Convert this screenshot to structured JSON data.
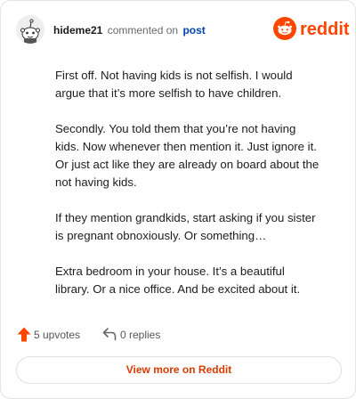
{
  "header": {
    "username": "hideme21",
    "commented_text": "commented on",
    "post_link": "post",
    "brand_wordmark": "reddit"
  },
  "comment": {
    "paragraphs": [
      "First off. Not having kids is not selfish. I would argue that it’s more selfish to have children.",
      "Secondly. You told them that you’re not having kids. Now whenever then mention it. Just ignore it. Or just act like they are already on board about the not having kids.",
      "If they mention grandkids, start asking if you sister is pregnant obnoxiously. Or something…",
      "Extra bedroom in your house. It’s a beautiful library. Or a nice office. And be excited about it."
    ]
  },
  "footer": {
    "upvotes_label": "5 upvotes",
    "replies_label": "0 replies",
    "view_more_label": "View more on Reddit"
  },
  "colors": {
    "brand": "#ff4500",
    "link": "#0045ac",
    "cta_text": "#d93a00"
  },
  "icons": {
    "avatar": "snoo-avatar-icon",
    "logo": "reddit-logo-icon",
    "upvote": "upvote-arrow-icon",
    "reply": "reply-arrow-icon"
  }
}
